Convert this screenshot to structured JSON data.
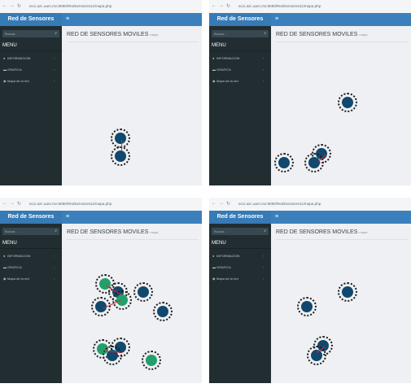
{
  "app": {
    "brand": "Red de Sensores",
    "search_placeholder": "Buscar...",
    "menu_header": "MENU",
    "menu_items": [
      {
        "label": "INFORMACION",
        "icon": "info-icon"
      },
      {
        "label": "GRAFICA",
        "icon": "chart-icon"
      },
      {
        "label": "Mapa de la red",
        "icon": "map-icon"
      }
    ],
    "page_title": "RED DE SENSORES MOVILES",
    "page_subtitle": "mapa"
  },
  "panels": [
    {
      "url": "ecci.azc.uam.mx:8080/RedSensores11/mapa.php"
    },
    {
      "url": "ecci.azc.uam.mx:8080/RedSensores11/mapa.php"
    },
    {
      "url": "ecci.azc.uam.mx:8080/RedSensores11/mapa.php"
    },
    {
      "url": "ecci.azc.uam.mx:8080/RedSensores11/mapa.php"
    }
  ],
  "colors": {
    "topbar": "#3b80bd",
    "sidebar": "#222d32",
    "node": "#11486e",
    "node_green": "#22a06b",
    "link": "#e0232d"
  }
}
